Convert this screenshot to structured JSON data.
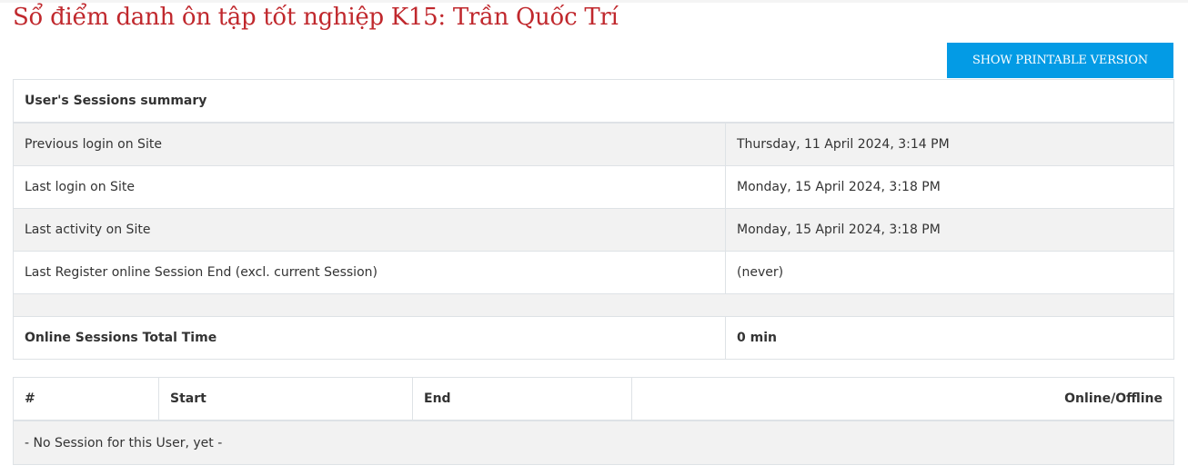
{
  "title": "Sổ điểm danh ôn tập tốt nghiệp K15: Trần Quốc Trí",
  "printable_button": "SHOW PRINTABLE VERSION",
  "summary": {
    "heading": "User's Sessions summary",
    "rows": [
      {
        "label": "Previous login on Site",
        "value": "Thursday, 11 April 2024, 3:14 PM"
      },
      {
        "label": "Last login on Site",
        "value": "Monday, 15 April 2024, 3:18 PM"
      },
      {
        "label": "Last activity on Site",
        "value": "Monday, 15 April 2024, 3:18 PM"
      },
      {
        "label": "Last Register online Session End (excl. current Session)",
        "value": "(never)"
      }
    ],
    "total": {
      "label": "Online Sessions Total Time",
      "value": "0 min"
    }
  },
  "sessions": {
    "headers": [
      "#",
      "Start",
      "End",
      "Online/Offline"
    ],
    "empty": "- No Session for this User, yet -"
  },
  "colors": {
    "title": "#c0282d",
    "button": "#039be5"
  }
}
